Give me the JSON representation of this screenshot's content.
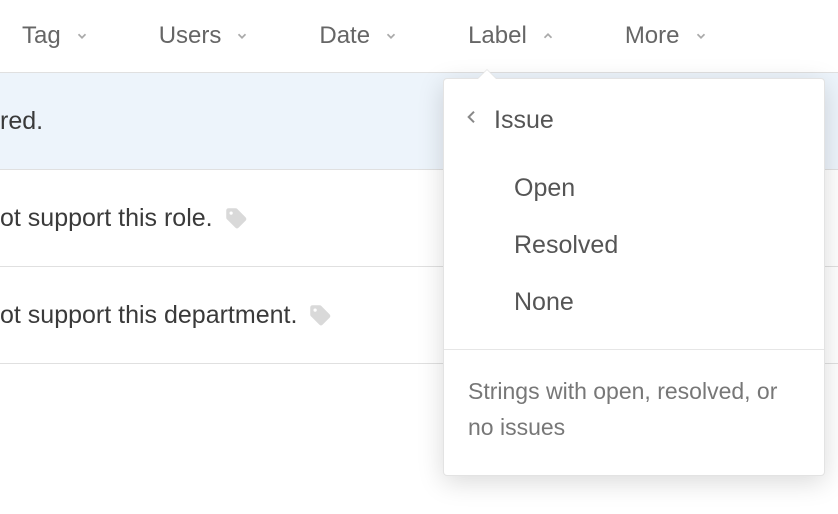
{
  "filters": {
    "tag": "Tag",
    "users": "Users",
    "date": "Date",
    "label": "Label",
    "more": "More"
  },
  "rows": [
    {
      "text": "red.",
      "tagged": false,
      "selected": true
    },
    {
      "text": "ot support this role.",
      "tagged": true,
      "selected": false
    },
    {
      "text": "ot support this department.",
      "tagged": true,
      "selected": false
    }
  ],
  "dropdown": {
    "header": "Issue",
    "options": [
      "Open",
      "Resolved",
      "None"
    ],
    "description": "Strings with open, resolved, or no issues"
  }
}
